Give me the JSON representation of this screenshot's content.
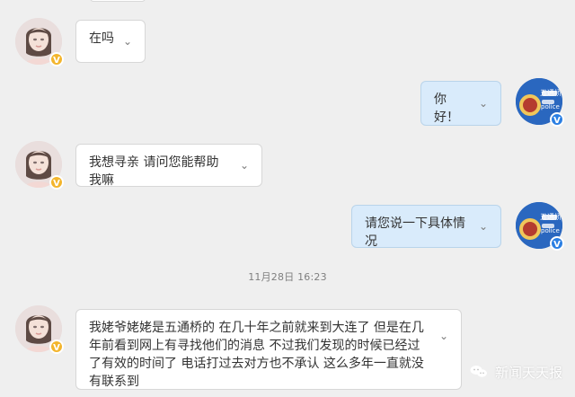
{
  "chat": {
    "timestamp": "11月28日 16:23",
    "messages": [
      {
        "side": "left",
        "text": "在吗"
      },
      {
        "side": "right",
        "text": "你好！"
      },
      {
        "side": "left",
        "text": "我想寻亲 请问您能帮助我嘛"
      },
      {
        "side": "right",
        "text": "请您说一下具体情况"
      },
      {
        "side": "left",
        "text": "我姥爷姥姥是五通桥的 在几十年之前就来到大连了 但是在几年前看到网上有寻找他们的消息 不过我们发现的时候已经过了有效的时间了 电话打过去对方也不承认 这么多年一直就没有联系到"
      }
    ]
  },
  "avatars": {
    "brand_label_top": "五通桥",
    "brand_label_bottom": "police",
    "badge_symbol": "V"
  },
  "watermark": {
    "text": "新闻天天报",
    "icon": "wechat-icon"
  },
  "colors": {
    "background": "#efefef",
    "left_bubble": "#ffffff",
    "right_bubble": "#d9ebfb",
    "brand_avatar": "#2a67bf",
    "badge_yellow": "#f3b52d",
    "badge_blue": "#2b7fe3"
  }
}
